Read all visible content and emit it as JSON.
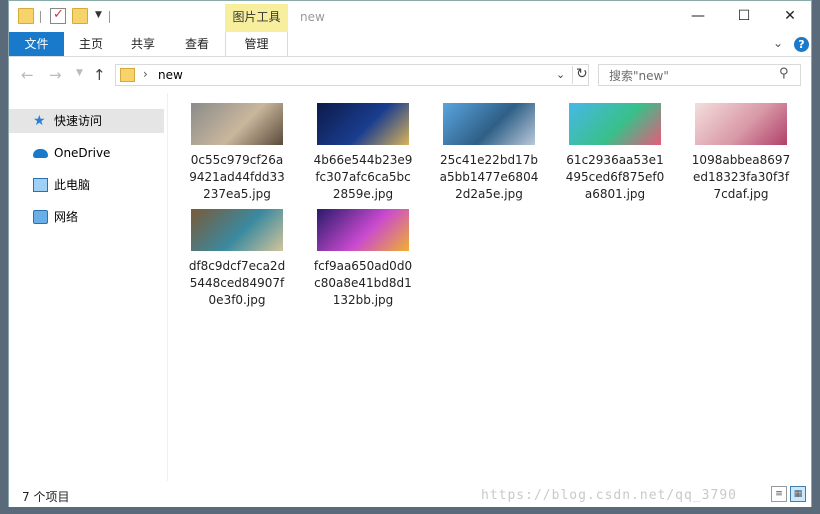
{
  "window": {
    "title": "new",
    "context_tab": "图片工具",
    "controls": {
      "minimize": "—",
      "maximize": "☐",
      "close": "✕"
    }
  },
  "ribbon": {
    "tabs": [
      "文件",
      "主页",
      "共享",
      "查看",
      "管理"
    ],
    "help": "?",
    "collapse": "⌄"
  },
  "address": {
    "separator": "›",
    "path": "new",
    "search_placeholder": "搜索\"new\""
  },
  "nav_pane": {
    "items": [
      {
        "label": "快速访问",
        "icon": "star-icon",
        "selected": true
      },
      {
        "label": "OneDrive",
        "icon": "cloud-icon",
        "selected": false
      },
      {
        "label": "此电脑",
        "icon": "computer-icon",
        "selected": false
      },
      {
        "label": "网络",
        "icon": "network-icon",
        "selected": false
      }
    ]
  },
  "files": [
    {
      "name": "0c55c979cf26a9421ad44fdd33237ea5.jpg",
      "thumb": [
        "#8b8b8b",
        "#c9b79c",
        "#5a4a3a"
      ]
    },
    {
      "name": "4b66e544b23e9fc307afc6ca5bc2859e.jpg",
      "thumb": [
        "#0c1a4a",
        "#1a3d8f",
        "#d9b45a"
      ]
    },
    {
      "name": "25c41e22bd17ba5bb1477e68042d2a5e.jpg",
      "thumb": [
        "#5aa5e0",
        "#2f5f86",
        "#b9c9d9"
      ]
    },
    {
      "name": "61c2936aa53e1495ced6f875ef0a6801.jpg",
      "thumb": [
        "#47b8e8",
        "#38c08a",
        "#e85a7a"
      ]
    },
    {
      "name": "1098abbea8697ed18323fa30f3f7cdaf.jpg",
      "thumb": [
        "#f3dede",
        "#d99aa8",
        "#b0406a"
      ]
    },
    {
      "name": "df8c9dcf7eca2d5448ced84907f0e3f0.jpg",
      "thumb": [
        "#7a5a3a",
        "#3a8aa0",
        "#d4c49a"
      ]
    },
    {
      "name": "fcf9aa650ad0d0c80a8e41bd8d1132bb.jpg",
      "thumb": [
        "#2a1a6a",
        "#c94ad0",
        "#f0b030"
      ]
    }
  ],
  "status": {
    "count": "7 个项目",
    "watermark": "https://blog.csdn.net/qq_3790"
  }
}
